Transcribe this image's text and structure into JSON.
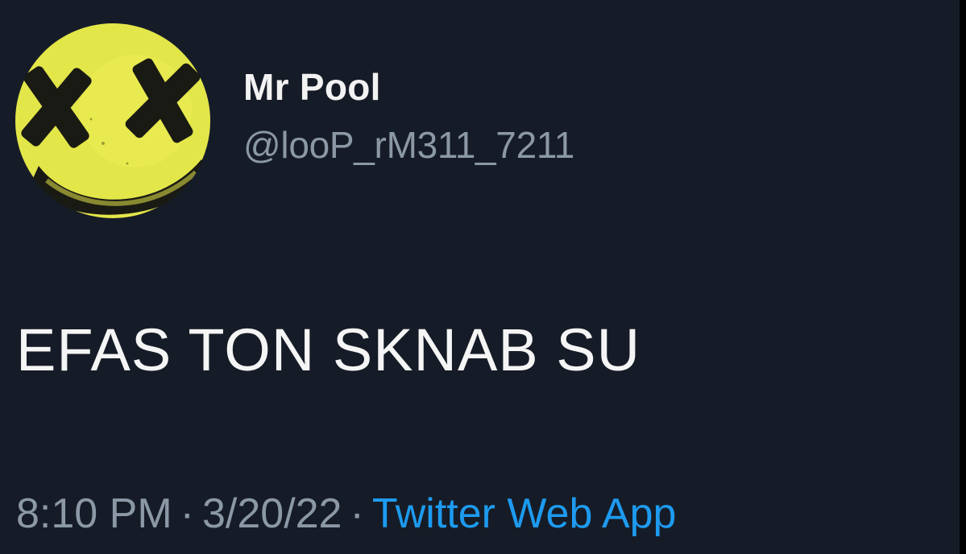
{
  "tweet": {
    "display_name": "Mr Pool",
    "handle": "@looP_rM311_7211",
    "text": "EFAS TON SKNAB SU",
    "time": "8:10 PM",
    "separator": "·",
    "date": "3/20/22",
    "source": "Twitter Web App"
  },
  "avatar": {
    "icon": "smiley-face-x-eyes-icon",
    "face_color": "#e5e84a"
  },
  "colors": {
    "background": "#161c27",
    "display_name": "#f2f2f2",
    "secondary_text": "#8b98a5",
    "link": "#1d9bf0"
  }
}
